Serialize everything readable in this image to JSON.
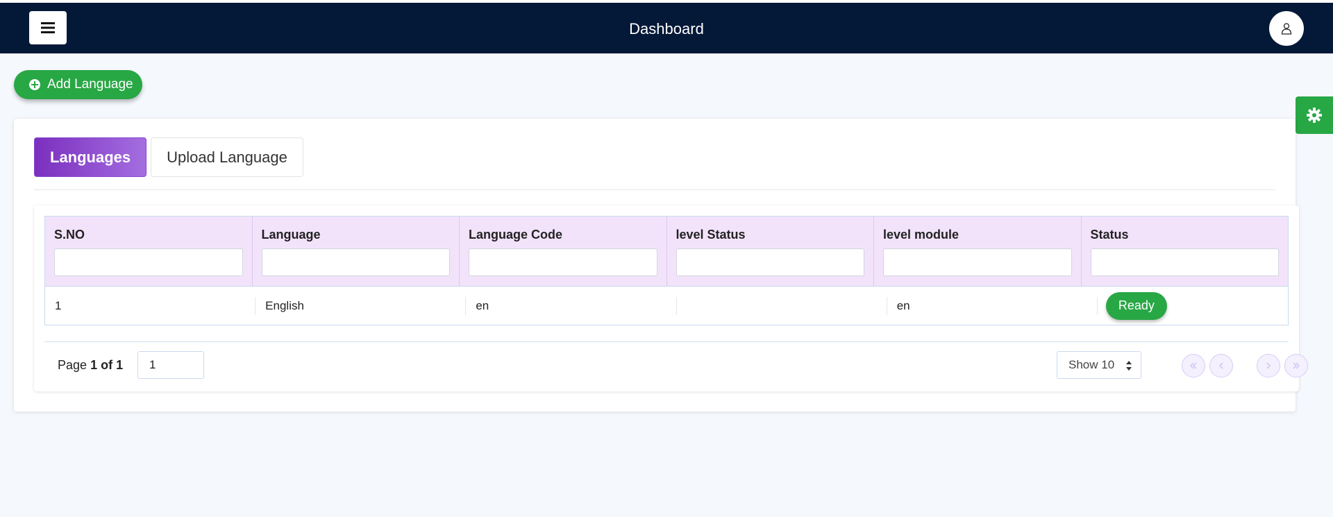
{
  "header": {
    "title": "Dashboard",
    "menu_icon": "hamburger-menu-icon",
    "user_icon": "user-icon"
  },
  "toolbar": {
    "add_label": "Add Language",
    "add_icon": "plus-circle-icon",
    "settings_icon": "gear-icon"
  },
  "tabs": [
    {
      "label": "Languages",
      "active": true
    },
    {
      "label": "Upload Language",
      "active": false
    }
  ],
  "table": {
    "columns": [
      "S.NO",
      "Language",
      "Language Code",
      "level Status",
      "level module",
      "Status"
    ],
    "filters": [
      "",
      "",
      "",
      "",
      "",
      ""
    ],
    "rows": [
      {
        "sno": "1",
        "language": "English",
        "code": "en",
        "level_status": "",
        "level_module": "en",
        "status": "Ready"
      }
    ]
  },
  "pagination": {
    "page_prefix": "Page",
    "page_info": "1 of 1",
    "page_input_value": "1",
    "page_size_label": "Show 10",
    "nav_icons": [
      "double-chevron-left-icon",
      "chevron-left-icon",
      "chevron-right-icon",
      "double-chevron-right-icon"
    ]
  },
  "colors": {
    "topbar": "#041838",
    "accent_green": "#28a745",
    "tab_active": "#7b2fbf",
    "header_row": "#f2e3fb"
  }
}
